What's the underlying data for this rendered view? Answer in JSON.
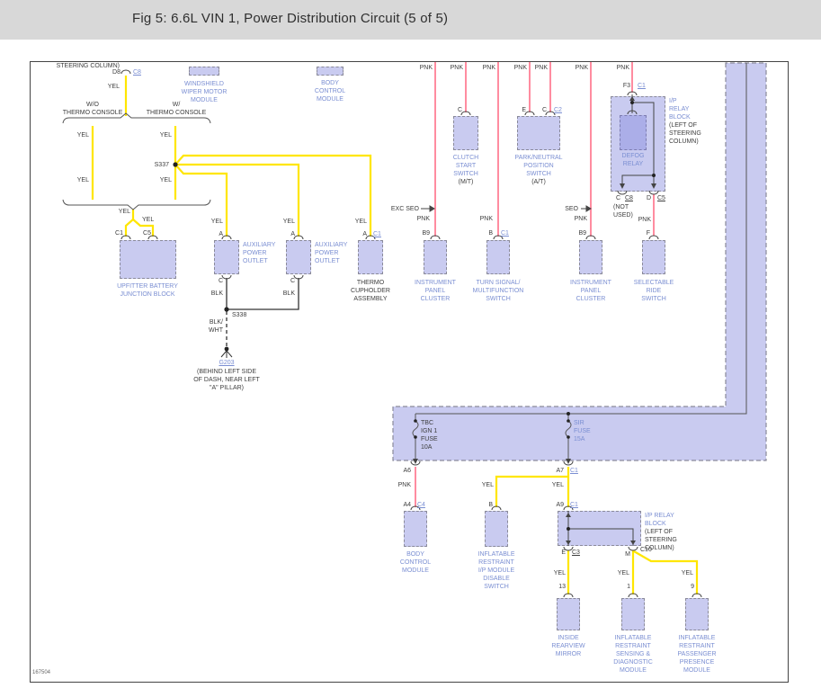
{
  "header": {
    "title": "Fig 5: 6.6L VIN 1, Power Distribution Circuit (5 of 5)"
  },
  "sheet_number": "167504",
  "wires": {
    "yel": "YEL",
    "pnk": "PNK",
    "blk": "BLK",
    "blk_wht": "BLK/\nWHT"
  },
  "annotations": {
    "steering_column": "STEERING COLUMN)",
    "wo_thermo": "W/O\nTHERMO CONSOLE",
    "w_thermo": "W/\nTHERMO CONSOLE",
    "exc_seo": "EXC SEO",
    "seo": "SEO",
    "not_used": "(NOT\nUSED)",
    "mt": "(M/T)",
    "at": "(A/T)",
    "left_of_steering": "(LEFT OF\nSTEERING\nCOLUMN)",
    "g203_location": "(BEHIND LEFT SIDE\nOF DASH, NEAR LEFT\n\"A\" PILLAR)"
  },
  "splices": {
    "s337": "S337",
    "s338": "S338",
    "g203": "G203"
  },
  "pins": {
    "d8": "D8",
    "a": "A",
    "b": "B",
    "c": "C",
    "d": "D",
    "e": "E",
    "f": "F",
    "m": "M",
    "f3": "F3",
    "b9": "B9",
    "a4": "A4",
    "a6": "A6",
    "a7": "A7",
    "a9": "A9",
    "n13": "13",
    "n1": "1",
    "n9": "9"
  },
  "connectors": {
    "c1": "C1",
    "c2": "C2",
    "c3": "C3",
    "c4": "C4",
    "c5": "C5",
    "c8": "C8",
    "c10": "C10"
  },
  "fuses": {
    "tbc": "TBC\nIGN 1\nFUSE\n10A",
    "sir": "SIR\nFUSE\n15A"
  },
  "components": {
    "windshield_wiper": "WINDSHIELD\nWIPER MOTOR\nMODULE",
    "body_control": "BODY\nCONTROL\nMODULE",
    "upfitter": "UPFITTER BATTERY\nJUNCTION BLOCK",
    "aux_outlet": "AUXILIARY\nPOWER\nOUTLET",
    "thermo_cupholder": "THERMO\nCUPHOLDER\nASSEMBLY",
    "ipc": "INSTRUMENT\nPANEL\nCLUSTER",
    "turn_signal": "TURN SIGNAL/\nMULTIFUNCTION\nSWITCH",
    "clutch_start": "CLUTCH\nSTART\nSWITCH",
    "park_neutral": "PARK/NEUTRAL\nPOSITION\nSWITCH",
    "ip_relay": "I/P\nRELAY\nBLOCK",
    "ip_relay2": "I/P RELAY\nBLOCK",
    "defog": "DEFOG\nRELAY",
    "selectable_ride": "SELECTABLE\nRIDE\nSWITCH",
    "ir_disable": "INFLATABLE\nRESTRAINT\nI/P MODULE\nDISABLE\nSWITCH",
    "mirror": "INSIDE\nREARVIEW\nMIRROR",
    "ir_sdm": "INFLATABLE\nRESTRAINT\nSENSING &\nDIAGNOSTIC\nMODULE",
    "ir_ppm": "INFLATABLE\nRESTRAINT\nPASSENGER\nPRESENCE\nMODULE"
  },
  "colors": {
    "yellow": "#FFE600",
    "pink": "#FF8CA0",
    "lavender": "#C9CBF0",
    "relay_fill": "#ABAEE8",
    "label_blue": "#7A8ED2",
    "text_dark": "#3D3D3D"
  }
}
